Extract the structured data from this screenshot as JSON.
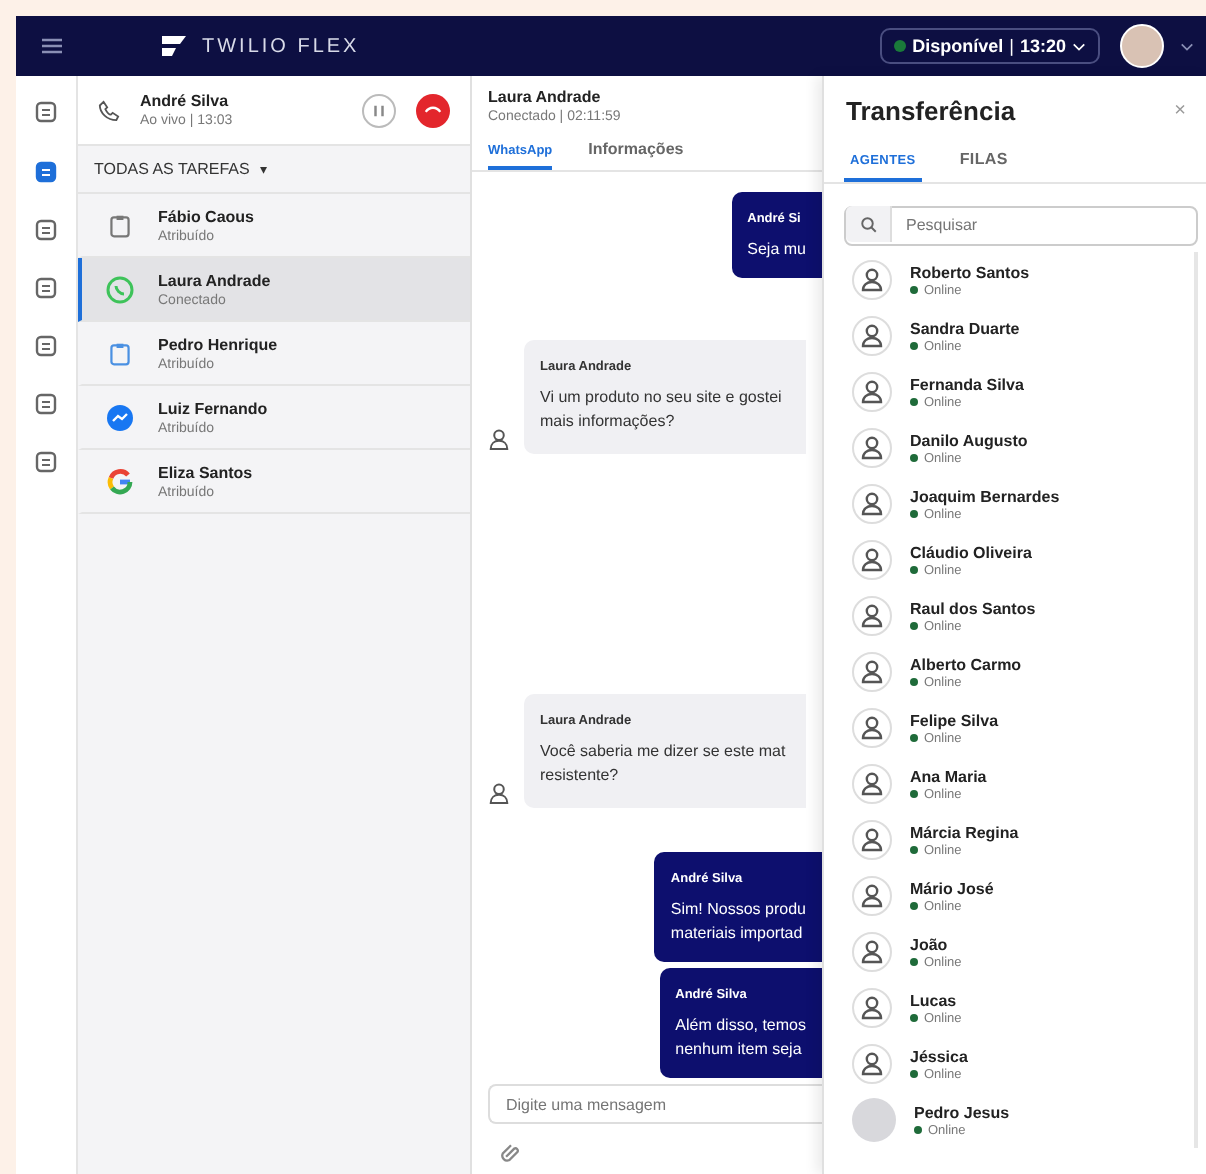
{
  "topbar": {
    "brand": "TWILIO FLEX",
    "status": "Disponível",
    "separator": "|",
    "time": "13:20"
  },
  "rail": [
    {
      "selected": false
    },
    {
      "selected": true
    },
    {
      "selected": false
    },
    {
      "selected": false
    },
    {
      "selected": false
    },
    {
      "selected": false
    },
    {
      "selected": false
    }
  ],
  "call": {
    "name": "André Silva",
    "detail": "Ao vivo | 13:03"
  },
  "filter": {
    "label": "TODAS AS TAREFAS",
    "caret": "▾"
  },
  "tasks": [
    {
      "kind": "clipboard",
      "name": "Fábio Caous",
      "status": "Atribuído",
      "selected": false
    },
    {
      "kind": "whatsapp",
      "name": "Laura Andrade",
      "status": "Conectado",
      "selected": true
    },
    {
      "kind": "clipboard",
      "name": "Pedro Henrique",
      "status": "Atribuído",
      "selected": false
    },
    {
      "kind": "messenger",
      "name": "Luiz Fernando",
      "status": "Atribuído",
      "selected": false
    },
    {
      "kind": "google",
      "name": "Eliza Santos",
      "status": "Atribuído",
      "selected": false
    }
  ],
  "chat": {
    "name": "Laura Andrade",
    "detail": "Conectado | 02:11:59",
    "tabs": [
      {
        "label": "WhatsApp",
        "selected": true
      },
      {
        "label": "Informações",
        "selected": false
      }
    ],
    "messages": [
      {
        "kind": "out",
        "author": "André Si",
        "lines": [
          "Seja mu"
        ]
      },
      {
        "kind": "in",
        "author": "Laura Andrade",
        "lines": [
          "Vi um produto no seu site e gostei",
          "mais informações?"
        ]
      },
      {
        "kind": "in",
        "author": "Laura Andrade",
        "lines": [
          "Você saberia me dizer se este mat",
          "resistente?"
        ]
      },
      {
        "kind": "out",
        "author": "André Silva",
        "lines": [
          "Sim! Nossos produ",
          "materiais importad"
        ]
      },
      {
        "kind": "out",
        "author": "André Silva",
        "lines": [
          "Além disso, temos",
          "nenhum item seja"
        ]
      }
    ],
    "input": {
      "placeholder": "Digite uma mensagem"
    }
  },
  "transfer": {
    "title": "Transferência",
    "close": "×",
    "tabs": [
      {
        "label": "AGENTES",
        "selected": true
      },
      {
        "label": "FILAS",
        "selected": false
      }
    ],
    "search": {
      "placeholder": "Pesquisar"
    },
    "agents": [
      {
        "name": "Roberto Santos",
        "status": "Online",
        "kind": "icon"
      },
      {
        "name": "Sandra Duarte",
        "status": "Online",
        "kind": "icon"
      },
      {
        "name": "Fernanda Silva",
        "status": "Online",
        "kind": "icon"
      },
      {
        "name": "Danilo Augusto",
        "status": "Online",
        "kind": "icon"
      },
      {
        "name": "Joaquim Bernardes",
        "status": "Online",
        "kind": "icon"
      },
      {
        "name": "Cláudio Oliveira",
        "status": "Online",
        "kind": "icon"
      },
      {
        "name": "Raul dos Santos",
        "status": "Online",
        "kind": "icon"
      },
      {
        "name": "Alberto Carmo",
        "status": "Online",
        "kind": "icon"
      },
      {
        "name": "Felipe Silva",
        "status": "Online",
        "kind": "icon"
      },
      {
        "name": "Ana Maria",
        "status": "Online",
        "kind": "icon"
      },
      {
        "name": "Márcia Regina",
        "status": "Online",
        "kind": "icon"
      },
      {
        "name": "Mário José",
        "status": "Online",
        "kind": "icon"
      },
      {
        "name": "João",
        "status": "Online",
        "kind": "icon"
      },
      {
        "name": "Lucas",
        "status": "Online",
        "kind": "icon"
      },
      {
        "name": "Jéssica",
        "status": "Online",
        "kind": "icon"
      },
      {
        "name": "Pedro Jesus",
        "status": "Online",
        "kind": "photo"
      }
    ]
  }
}
